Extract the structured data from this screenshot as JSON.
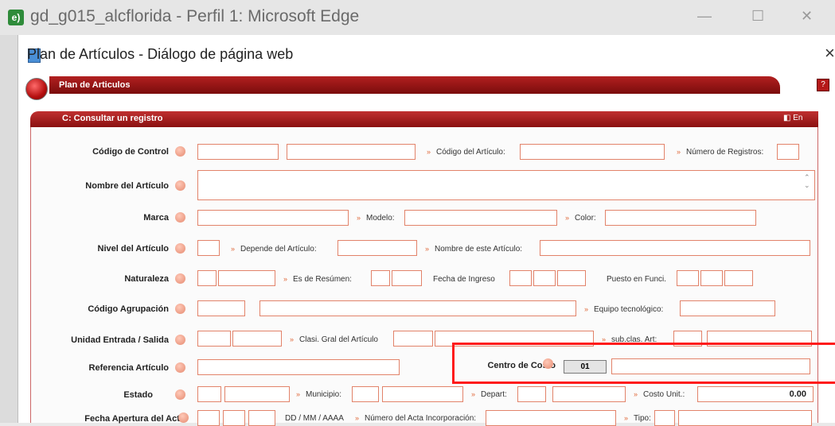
{
  "window": {
    "title": "gd_g015_alcflorida - Perfil 1: Microsoft Edge",
    "logo": "e)"
  },
  "dialog": {
    "title": "Plan de Artículos - Diálogo de página web",
    "close": "×"
  },
  "banner": {
    "title": "Plan de Articulos",
    "help": "?"
  },
  "section": {
    "title": "C: Consultar un registro",
    "icons": "◧ En"
  },
  "labels": {
    "codigo_control": "Código de Control",
    "codigo_articulo": "Código del Artículo:",
    "num_registros": "Número de Registros:",
    "nombre_articulo": "Nombre del Artículo",
    "marca": "Marca",
    "modelo": "Modelo:",
    "color": "Color:",
    "nivel_articulo": "Nivel del Artículo",
    "depende_articulo": "Depende del Artículo:",
    "nombre_este_articulo": "Nombre de este Artículo:",
    "naturaleza": "Naturaleza",
    "es_resumen": "Es de Resúmen:",
    "fecha_ingreso": "Fecha de Ingreso",
    "puesto_funci": "Puesto en Funci.",
    "codigo_agrupacion": "Código Agrupación",
    "equipo_tecnologico": "Equipo tecnológico:",
    "unidad_entrada": "Unidad Entrada / Salida",
    "clasi_gral": "Clasi. Gral del Artículo",
    "sub_clas": "sub.clas. Art:",
    "referencia": "Referencia Artículo",
    "centro_costo": "Centro de Costo",
    "estado": "Estado",
    "municipio": "Municipio:",
    "depart": "Depart:",
    "costo_unit": "Costo Unit.:",
    "fecha_apertura": "Fecha Apertura del Acta",
    "dd_mm_aaaa": "DD / MM / AAAA",
    "numero_acta": "Número del Acta Incorporación:",
    "tipo": "Tipo:"
  },
  "values": {
    "centro_costo_code": "01",
    "costo_unit": "0.00"
  },
  "colors": {
    "accent": "#a01414",
    "field_border": "#e2836a",
    "highlight": "#ff1a1a"
  }
}
